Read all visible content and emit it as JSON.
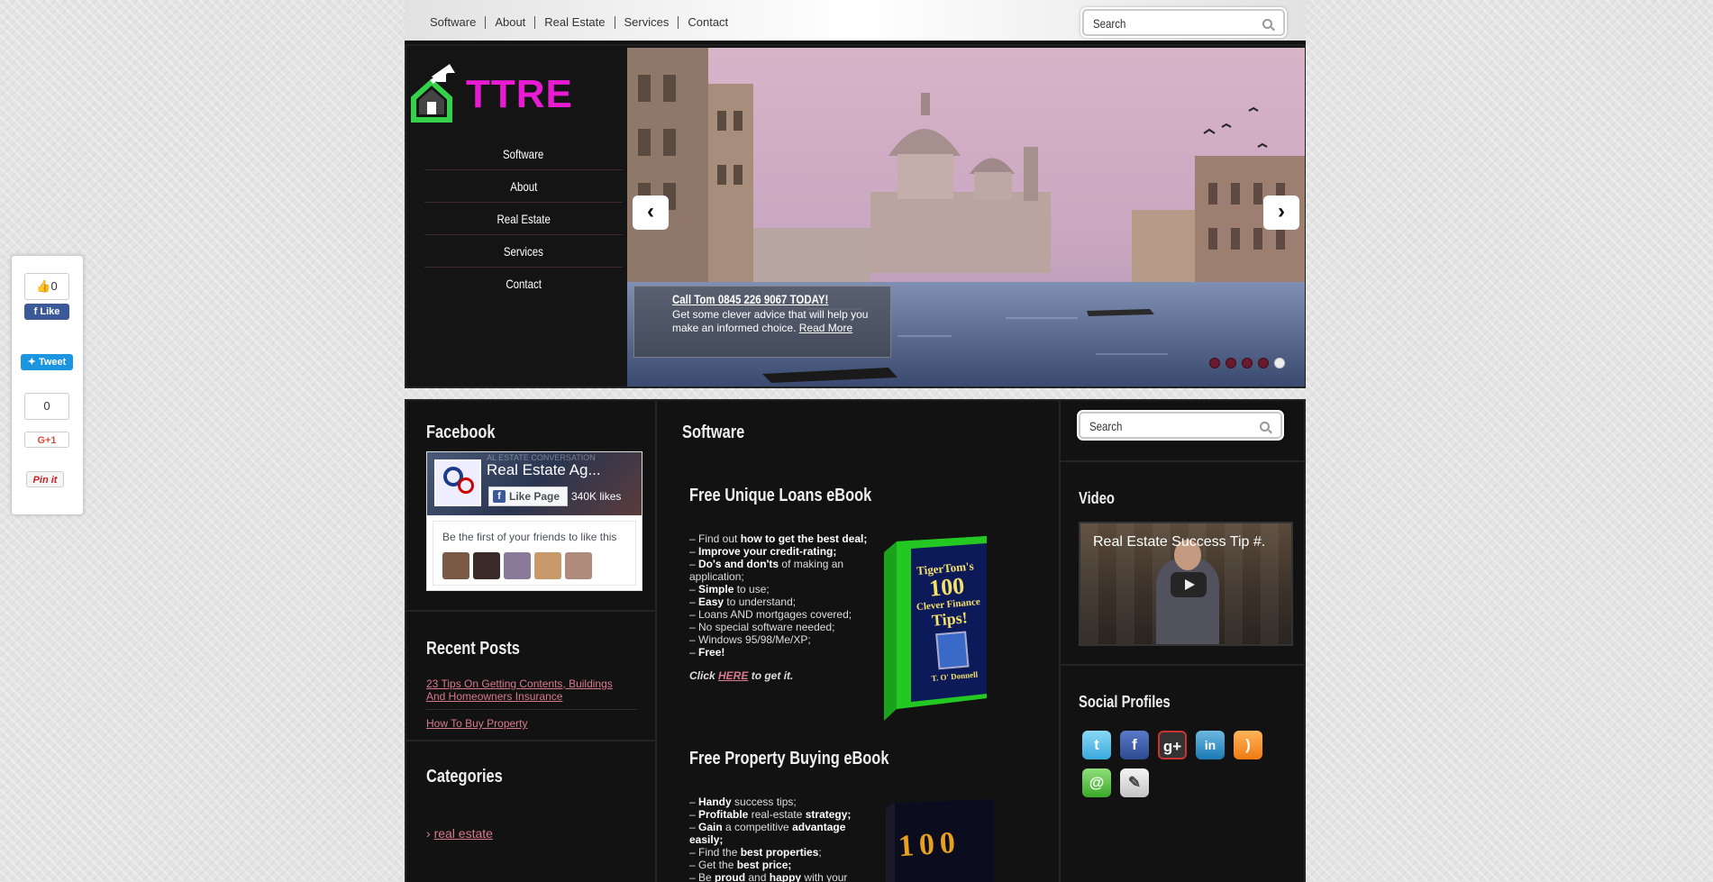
{
  "top_nav": {
    "items": [
      "Software",
      "About",
      "Real Estate",
      "Services",
      "Contact"
    ]
  },
  "top_search": {
    "placeholder": "Search"
  },
  "logo": {
    "text": "TTRE"
  },
  "main_nav": {
    "items": [
      "Software",
      "About",
      "Real Estate",
      "Services",
      "Contact"
    ]
  },
  "slider": {
    "prev": "‹",
    "next": "›",
    "caption_title": "Call Tom 0845 226 9067 TODAY!",
    "caption_text": "Get some clever advice that will help you make an informed choice.",
    "read_more": "Read More",
    "dots": 5,
    "active_dot": 5
  },
  "facebook": {
    "title": "Facebook",
    "page_name": "Real Estate Ag...",
    "cover_text": "AL ESTATE CONVERSATION",
    "like_page": "Like Page",
    "likes": "340K likes",
    "friends_text": "Be the first of your friends to like this"
  },
  "recent_posts": {
    "title": "Recent Posts",
    "items": [
      "23 Tips On Getting Contents, Buildings And Homeowners Insurance",
      "How To Buy Property"
    ]
  },
  "categories": {
    "title": "Categories",
    "items": [
      "real estate"
    ]
  },
  "main": {
    "title": "Software",
    "ebook1": {
      "title": "Free Unique Loans eBook",
      "lines": [
        [
          "– Find out ",
          "how to get the best deal;"
        ],
        [
          "– ",
          "Improve your credit-rating;"
        ],
        [
          "– ",
          "Do's and don'ts",
          " of making an application;"
        ],
        [
          "– ",
          "Simple",
          " to use;"
        ],
        [
          "– ",
          "Easy",
          " to understand;"
        ],
        [
          "– Loans AND mortgages covered;"
        ],
        [
          "– No special software needed;"
        ],
        [
          "– Windows 95/98/Me/XP;"
        ],
        [
          "– ",
          "Free!"
        ]
      ],
      "click_prefix": "Click ",
      "click_link": "HERE",
      "click_suffix": " to get it.",
      "cover_line1": "TigerTom's",
      "cover_line2": "100",
      "cover_line3": "Clever Finance",
      "cover_line4": "Tips!",
      "cover_author": "T. O' Donnell"
    },
    "ebook2": {
      "title": "Free Property Buying eBook",
      "lines": [
        [
          "– ",
          "Handy",
          " success tips;"
        ],
        [
          "– ",
          "Profitable",
          " real-estate ",
          "strategy;"
        ],
        [
          "– ",
          "Gain",
          " a competitive ",
          "advantage easily;"
        ],
        [
          "– Find the ",
          "best properties",
          ";"
        ],
        [
          "– Get the ",
          "best price;"
        ],
        [
          "– Be ",
          "proud",
          " and ",
          "happy",
          " with your"
        ]
      ],
      "cover_text": "100"
    }
  },
  "right": {
    "search_placeholder": "Search",
    "video_title": "Video",
    "video_caption": "Real Estate Success Tip #.",
    "social_title": "Social Profiles",
    "social": [
      "twitter-icon",
      "facebook-icon",
      "google-plus-icon",
      "linkedin-icon",
      "rss-icon",
      "email-icon",
      "blog-icon"
    ]
  },
  "share": {
    "fb_count": "0",
    "fb_like": "Like",
    "tweet": "Tweet",
    "gplus_count": "0",
    "gplus": "G+1",
    "pin": "Pin it"
  },
  "colors": {
    "accent_pink": "#d87a8e",
    "logo_magenta": "#e81bd3",
    "logo_green": "#35d14a"
  }
}
